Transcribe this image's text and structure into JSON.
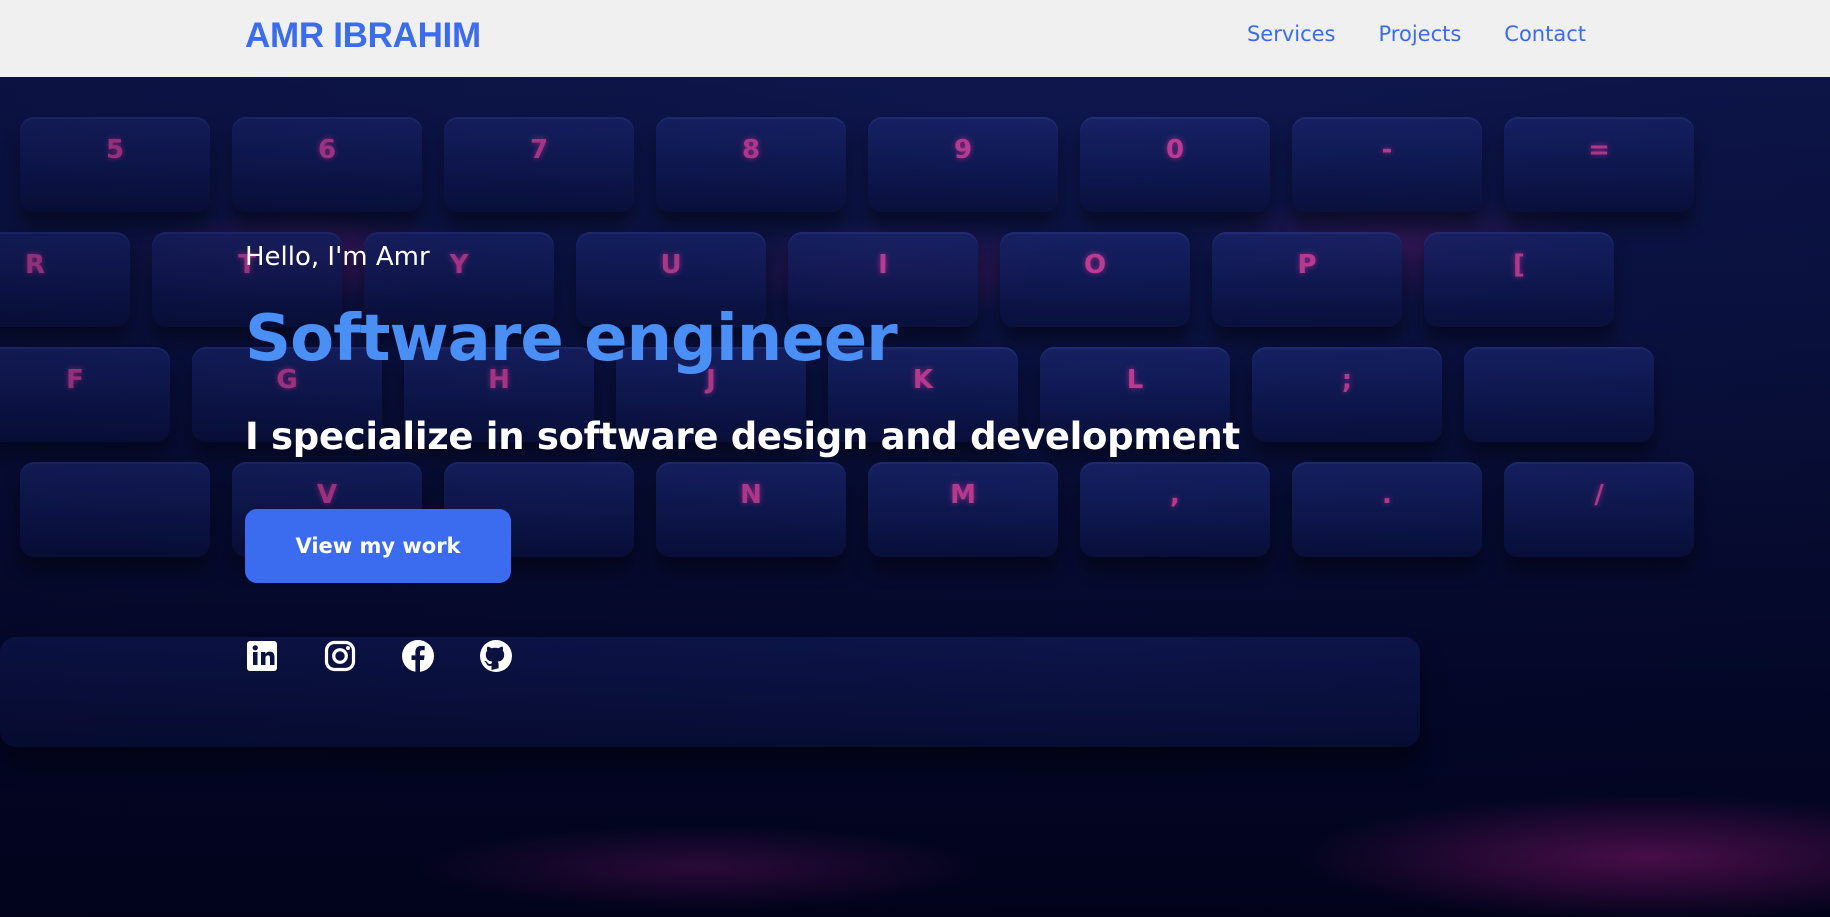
{
  "nav": {
    "brand": "AMR IBRAHIM",
    "links": [
      {
        "label": "Services"
      },
      {
        "label": "Projects"
      },
      {
        "label": "Contact"
      }
    ]
  },
  "hero": {
    "greeting": "Hello, I'm Amr",
    "role": "Software engineer",
    "tagline": "I specialize in software design and development",
    "cta_label": "View my work",
    "background_keys": {
      "row1": [
        "5",
        "6",
        "7",
        "8",
        "9",
        "0",
        "-",
        "="
      ],
      "row2": [
        "R",
        "T",
        "Y",
        "U",
        "I",
        "O",
        "P",
        "["
      ],
      "row3": [
        "F",
        "G",
        "H",
        "J",
        "K",
        "L",
        ";",
        ""
      ],
      "row4": [
        "",
        "V",
        "",
        "N",
        "M",
        ",",
        ".",
        "/"
      ]
    },
    "socials": [
      {
        "icon": "linkedin-icon"
      },
      {
        "icon": "instagram-icon"
      },
      {
        "icon": "facebook-icon"
      },
      {
        "icon": "github-icon"
      }
    ]
  },
  "colors": {
    "accent": "#3b6cf0",
    "role_text": "#4a8ff5",
    "navbar_bg": "#f0f0f0",
    "hero_dark": "#03041e",
    "key_glow": "#ff4fb8"
  }
}
